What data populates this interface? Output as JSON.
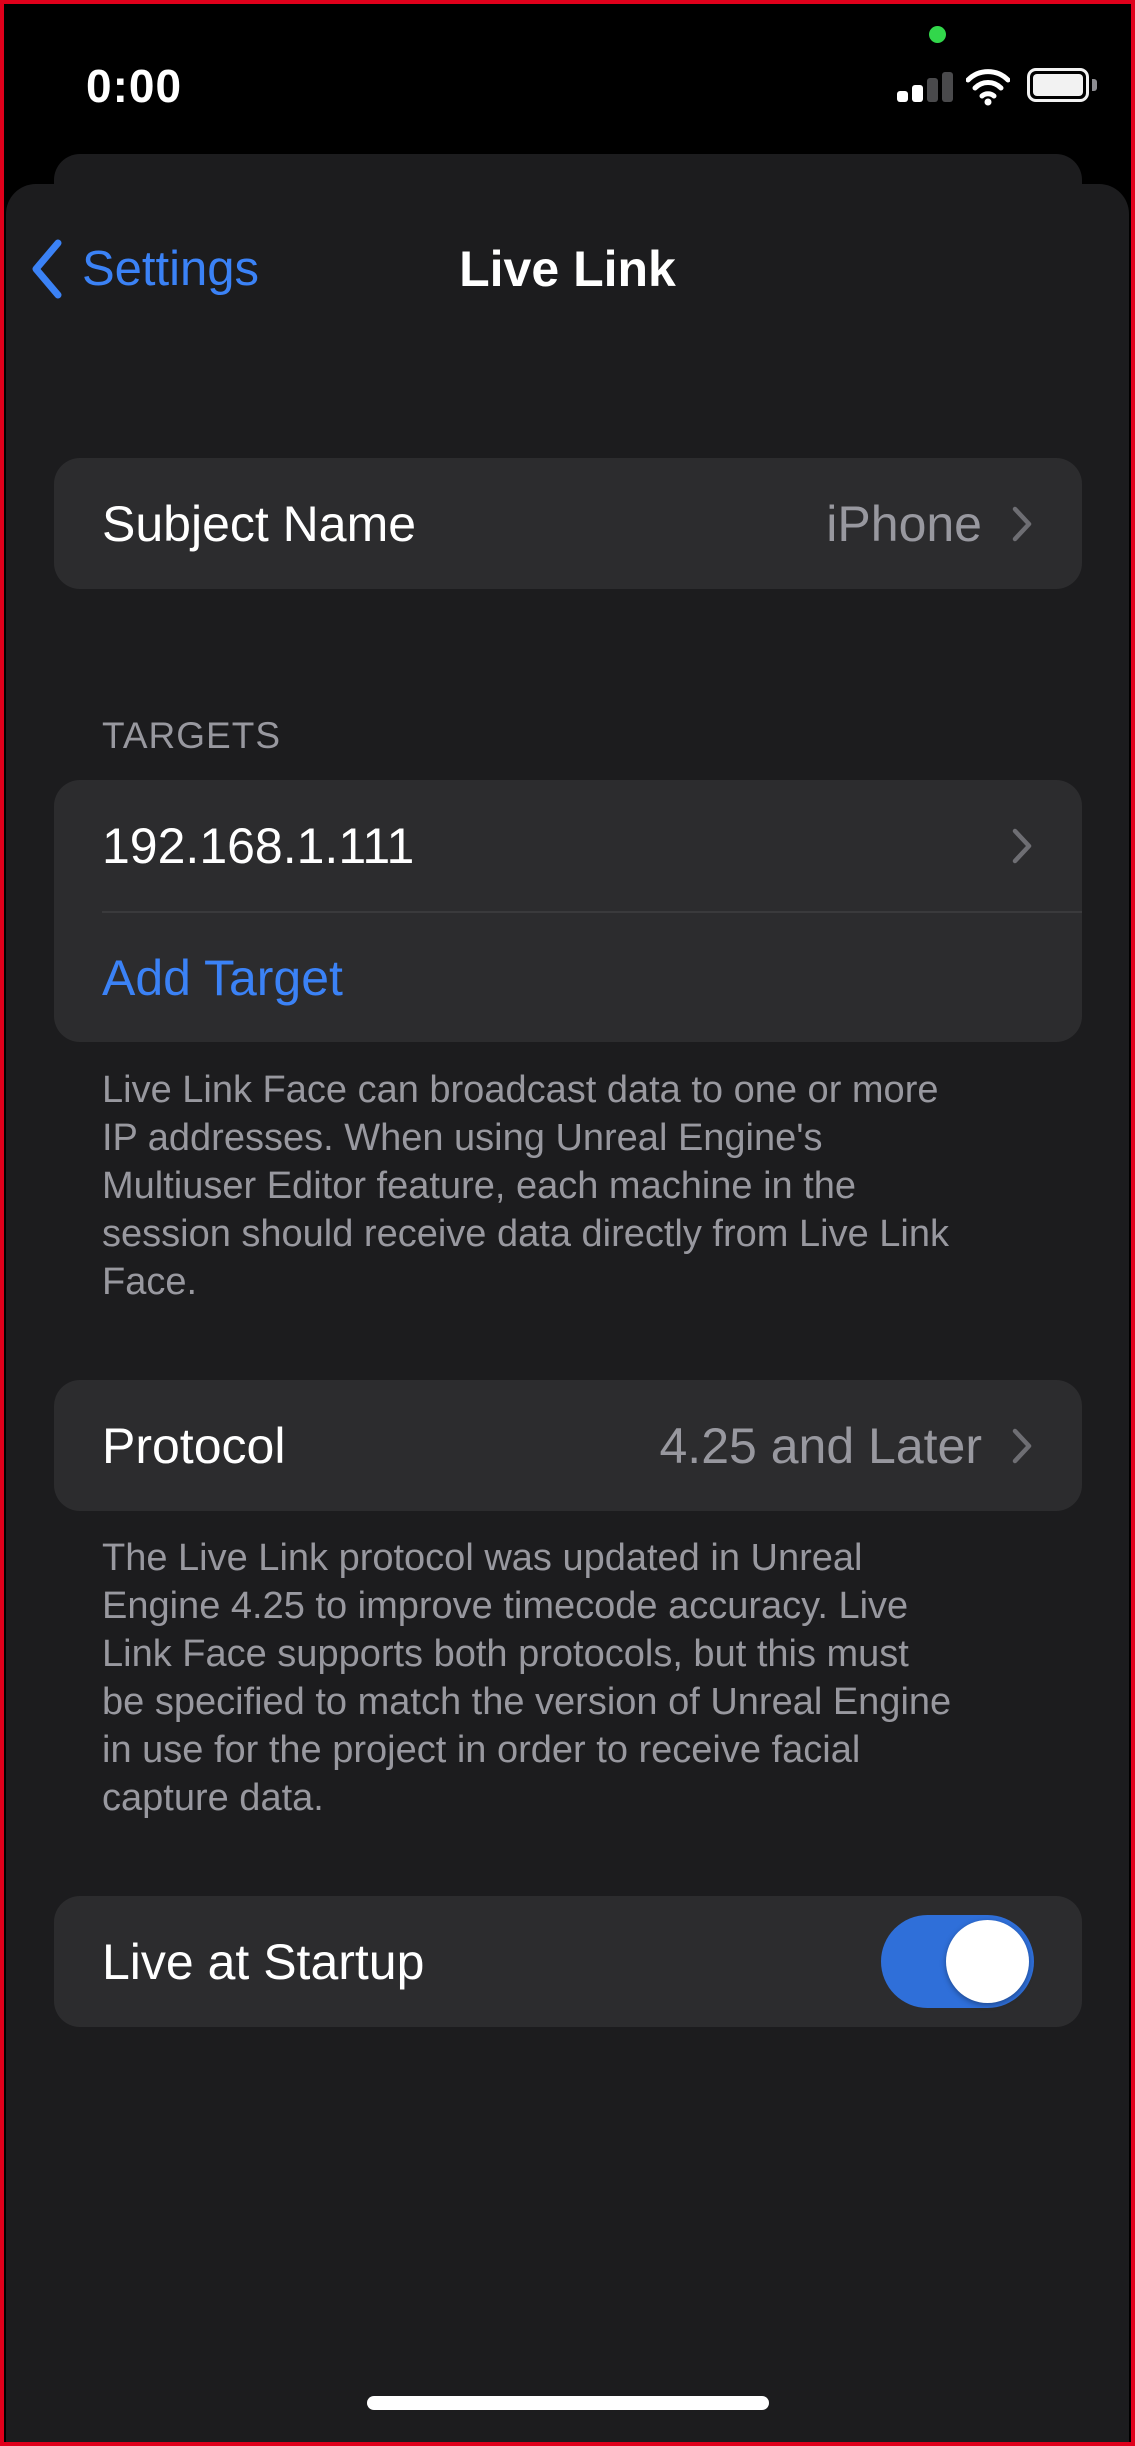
{
  "status_bar": {
    "time": "0:00"
  },
  "nav": {
    "back_label": "Settings",
    "title": "Live Link"
  },
  "subject": {
    "label": "Subject Name",
    "value": "iPhone"
  },
  "targets": {
    "header": "TARGETS",
    "items": [
      "192.168.1.111"
    ],
    "add_label": "Add Target",
    "footer": "Live Link Face can broadcast data to one or more\nIP addresses. When using Unreal Engine's\nMultiuser Editor feature, each machine in the\nsession should receive data directly from Live Link\nFace."
  },
  "protocol": {
    "label": "Protocol",
    "value": "4.25 and Later",
    "footer": "The Live Link protocol was updated in Unreal\nEngine 4.25 to improve timecode accuracy.  Live\nLink Face supports both protocols, but this must\nbe specified to match the version of Unreal Engine\nin use for the project in order to receive facial\ncapture data."
  },
  "startup": {
    "label": "Live at Startup",
    "enabled": true
  },
  "colors": {
    "accent": "#3b82f6",
    "toggle_on": "#2f6fd9",
    "background": "#1c1c1e",
    "cell": "#2c2c2e",
    "secondary_text": "#98989f"
  },
  "icons": {
    "back": "chevron-left-icon",
    "disclosure": "chevron-right-icon",
    "signal": "cellular-signal-icon",
    "wifi": "wifi-icon",
    "battery": "battery-icon"
  }
}
